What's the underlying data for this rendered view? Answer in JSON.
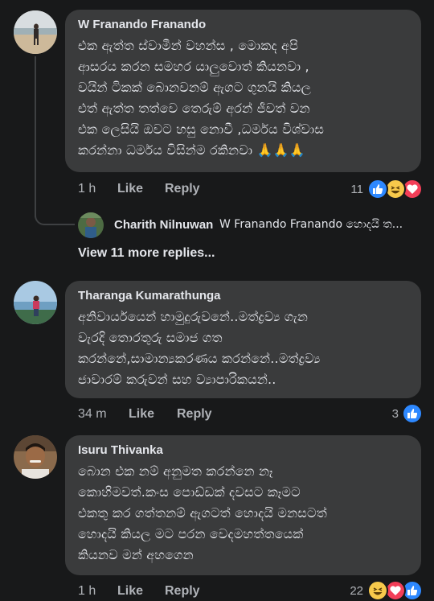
{
  "comments": [
    {
      "author": "W Franando Franando",
      "lines": [
        "එක ඇත්ත ස්වාමීන් වහන්ස , මොකද අපි",
        "ආසරය කරන සමහර යාලුවොත් කියනවා ,",
        "වයින් ටිකක් බොනවනම් ඇගට ගුනයි කියල",
        "එත් ඇත්ත තත්වෙ තෙරුම් අරන් ජීවත් වන",
        "එක ලෙසියි ඔවට හසු නොවී ,ධර්මය විශ්වාස",
        "කරන්නා ධර්මය විසින්ම රකිනවා 🙏🙏🙏"
      ],
      "time": "1 h",
      "like": "Like",
      "reply": "Reply",
      "reaction_count": "11",
      "reactions": [
        "like-reaction-icon",
        "haha-reaction-icon",
        "love-reaction-icon"
      ]
    },
    {
      "author": "Tharanga Kumarathunga",
      "lines": [
        "අනිවාර්යයෙන් හාමුදුරුවනේ..මත්ද්‍රව්‍ය ගැන",
        "වැරදි තොරතුරු සමාජ ගත",
        "කරන්නේ,සාමාන්‍යකරණය කරන්නේ..මත්ද්‍රව්‍ය",
        "ජාවාරම් කරුවන් සහ ව්‍යාපාරිකයන්.."
      ],
      "time": "34 m",
      "like": "Like",
      "reply": "Reply",
      "reaction_count": "3",
      "reactions": [
        "like-reaction-icon"
      ]
    },
    {
      "author": "Isuru Thivanka",
      "lines": [
        "බොන එක නම් අනුමත කරන්නෙ නෑ",
        "කොහිමවත්.කංස පොඩ්ඩක් දවසට කෑමට",
        "එකතු කර ගත්තනම් ඇගටත් හොදයි මනසටත්",
        "හොදයි කියල මට පරන වෙදමහත්තයෙක්",
        "කියනව මන් අහගෙන"
      ],
      "time": "1 h",
      "like": "Like",
      "reply": "Reply",
      "reaction_count": "22",
      "reactions": [
        "haha-reaction-icon",
        "love-reaction-icon",
        "like-reaction-icon"
      ]
    }
  ],
  "reply_preview": {
    "name": "Charith Nilnuwan",
    "snippet": "W Franando Franando හොදයි ත..."
  },
  "view_more": "View 11 more replies...",
  "colors": {
    "background": "#18191a",
    "bubble": "#3a3b3c",
    "text": "#e4e6eb",
    "muted": "#b0b3b8",
    "like_blue": "#2d88ff",
    "love_red": "#f33e58",
    "haha_yellow": "#f7c94b"
  }
}
